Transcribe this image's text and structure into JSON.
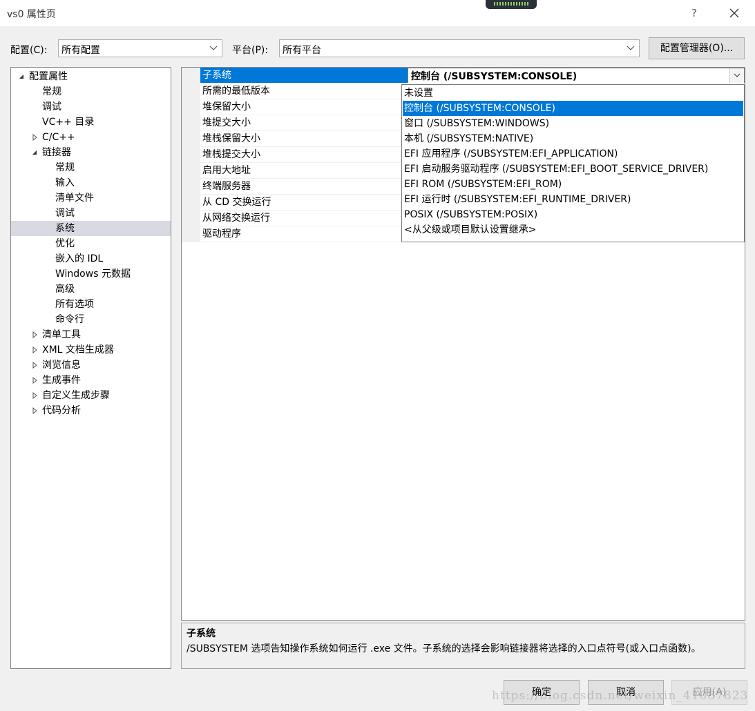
{
  "window": {
    "title": "vs0 属性页",
    "help": "?",
    "close": "✕"
  },
  "top": {
    "config_label": "配置(C):",
    "config_value": "所有配置",
    "platform_label": "平台(P):",
    "platform_value": "所有平台",
    "config_manager": "配置管理器(O)..."
  },
  "tree": {
    "items": [
      {
        "label": "配置属性",
        "level": 0,
        "expander": "expanded"
      },
      {
        "label": "常规",
        "level": 1,
        "expander": "none"
      },
      {
        "label": "调试",
        "level": 1,
        "expander": "none"
      },
      {
        "label": "VC++ 目录",
        "level": 1,
        "expander": "none"
      },
      {
        "label": "C/C++",
        "level": 1,
        "expander": "collapsed"
      },
      {
        "label": "链接器",
        "level": 1,
        "expander": "expanded"
      },
      {
        "label": "常规",
        "level": 2,
        "expander": "none"
      },
      {
        "label": "输入",
        "level": 2,
        "expander": "none"
      },
      {
        "label": "清单文件",
        "level": 2,
        "expander": "none"
      },
      {
        "label": "调试",
        "level": 2,
        "expander": "none"
      },
      {
        "label": "系统",
        "level": 2,
        "expander": "none",
        "selected": true
      },
      {
        "label": "优化",
        "level": 2,
        "expander": "none"
      },
      {
        "label": "嵌入的 IDL",
        "level": 2,
        "expander": "none"
      },
      {
        "label": "Windows 元数据",
        "level": 2,
        "expander": "none"
      },
      {
        "label": "高级",
        "level": 2,
        "expander": "none"
      },
      {
        "label": "所有选项",
        "level": 2,
        "expander": "none"
      },
      {
        "label": "命令行",
        "level": 2,
        "expander": "none"
      },
      {
        "label": "清单工具",
        "level": 1,
        "expander": "collapsed"
      },
      {
        "label": "XML 文档生成器",
        "level": 1,
        "expander": "collapsed"
      },
      {
        "label": "浏览信息",
        "level": 1,
        "expander": "collapsed"
      },
      {
        "label": "生成事件",
        "level": 1,
        "expander": "collapsed"
      },
      {
        "label": "自定义生成步骤",
        "level": 1,
        "expander": "collapsed"
      },
      {
        "label": "代码分析",
        "level": 1,
        "expander": "collapsed"
      }
    ]
  },
  "grid": {
    "properties": [
      "子系统",
      "所需的最低版本",
      "堆保留大小",
      "堆提交大小",
      "堆栈保留大小",
      "堆栈提交大小",
      "启用大地址",
      "终端服务器",
      "从 CD 交换运行",
      "从网络交换运行",
      "驱动程序"
    ],
    "selected_value": "控制台 (/SUBSYSTEM:CONSOLE)"
  },
  "dropdown": {
    "options": [
      "未设置",
      "控制台 (/SUBSYSTEM:CONSOLE)",
      "窗口 (/SUBSYSTEM:WINDOWS)",
      "本机 (/SUBSYSTEM:NATIVE)",
      "EFI 应用程序 (/SUBSYSTEM:EFI_APPLICATION)",
      "EFI 启动服务驱动程序 (/SUBSYSTEM:EFI_BOOT_SERVICE_DRIVER)",
      "EFI ROM (/SUBSYSTEM:EFI_ROM)",
      "EFI 运行时 (/SUBSYSTEM:EFI_RUNTIME_DRIVER)",
      "POSIX (/SUBSYSTEM:POSIX)",
      "<从父级或项目默认设置继承>"
    ],
    "selected_index": 1
  },
  "description": {
    "title": "子系统",
    "text": "/SUBSYSTEM 选项告知操作系统如何运行 .exe 文件。子系统的选择会影响链接器将选择的入口点符号(或入口点函数)。"
  },
  "buttons": {
    "ok": "确定",
    "cancel": "取消",
    "apply": "应用(A)"
  },
  "watermark": "https://blog.csdn.net/weixin_41087823",
  "colors": {
    "accent": "#0078d7",
    "tree_selection": "#d9d9e1"
  }
}
